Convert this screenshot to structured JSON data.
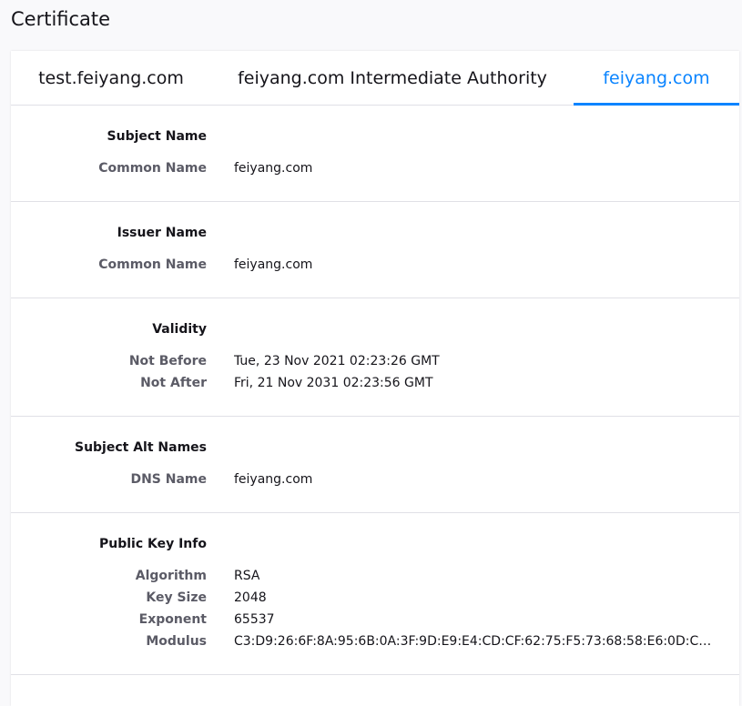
{
  "page": {
    "title": "Certificate"
  },
  "tabs": [
    {
      "label": "test.feiyang.com",
      "selected": false
    },
    {
      "label": "feiyang.com Intermediate Authority",
      "selected": false
    },
    {
      "label": "feiyang.com",
      "selected": true
    }
  ],
  "colors": {
    "accent": "#0a84ff",
    "label": "#5b5b66",
    "divider": "#e0e0e6"
  },
  "sections": {
    "subject": {
      "heading": "Subject Name",
      "common_name_label": "Common Name",
      "common_name_value": "feiyang.com"
    },
    "issuer": {
      "heading": "Issuer Name",
      "common_name_label": "Common Name",
      "common_name_value": "feiyang.com"
    },
    "validity": {
      "heading": "Validity",
      "not_before_label": "Not Before",
      "not_before_value": "Tue, 23 Nov 2021 02:23:26 GMT",
      "not_after_label": "Not After",
      "not_after_value": "Fri, 21 Nov 2031 02:23:56 GMT"
    },
    "alt_names": {
      "heading": "Subject Alt Names",
      "dns_label": "DNS Name",
      "dns_value": "feiyang.com"
    },
    "public_key": {
      "heading": "Public Key Info",
      "algorithm_label": "Algorithm",
      "algorithm_value": "RSA",
      "key_size_label": "Key Size",
      "key_size_value": "2048",
      "exponent_label": "Exponent",
      "exponent_value": "65537",
      "modulus_label": "Modulus",
      "modulus_value": "C3:D9:26:6F:8A:95:6B:0A:3F:9D:E9:E4:CD:CF:62:75:F5:73:68:58:E6:0D:C5:0A:…"
    }
  }
}
